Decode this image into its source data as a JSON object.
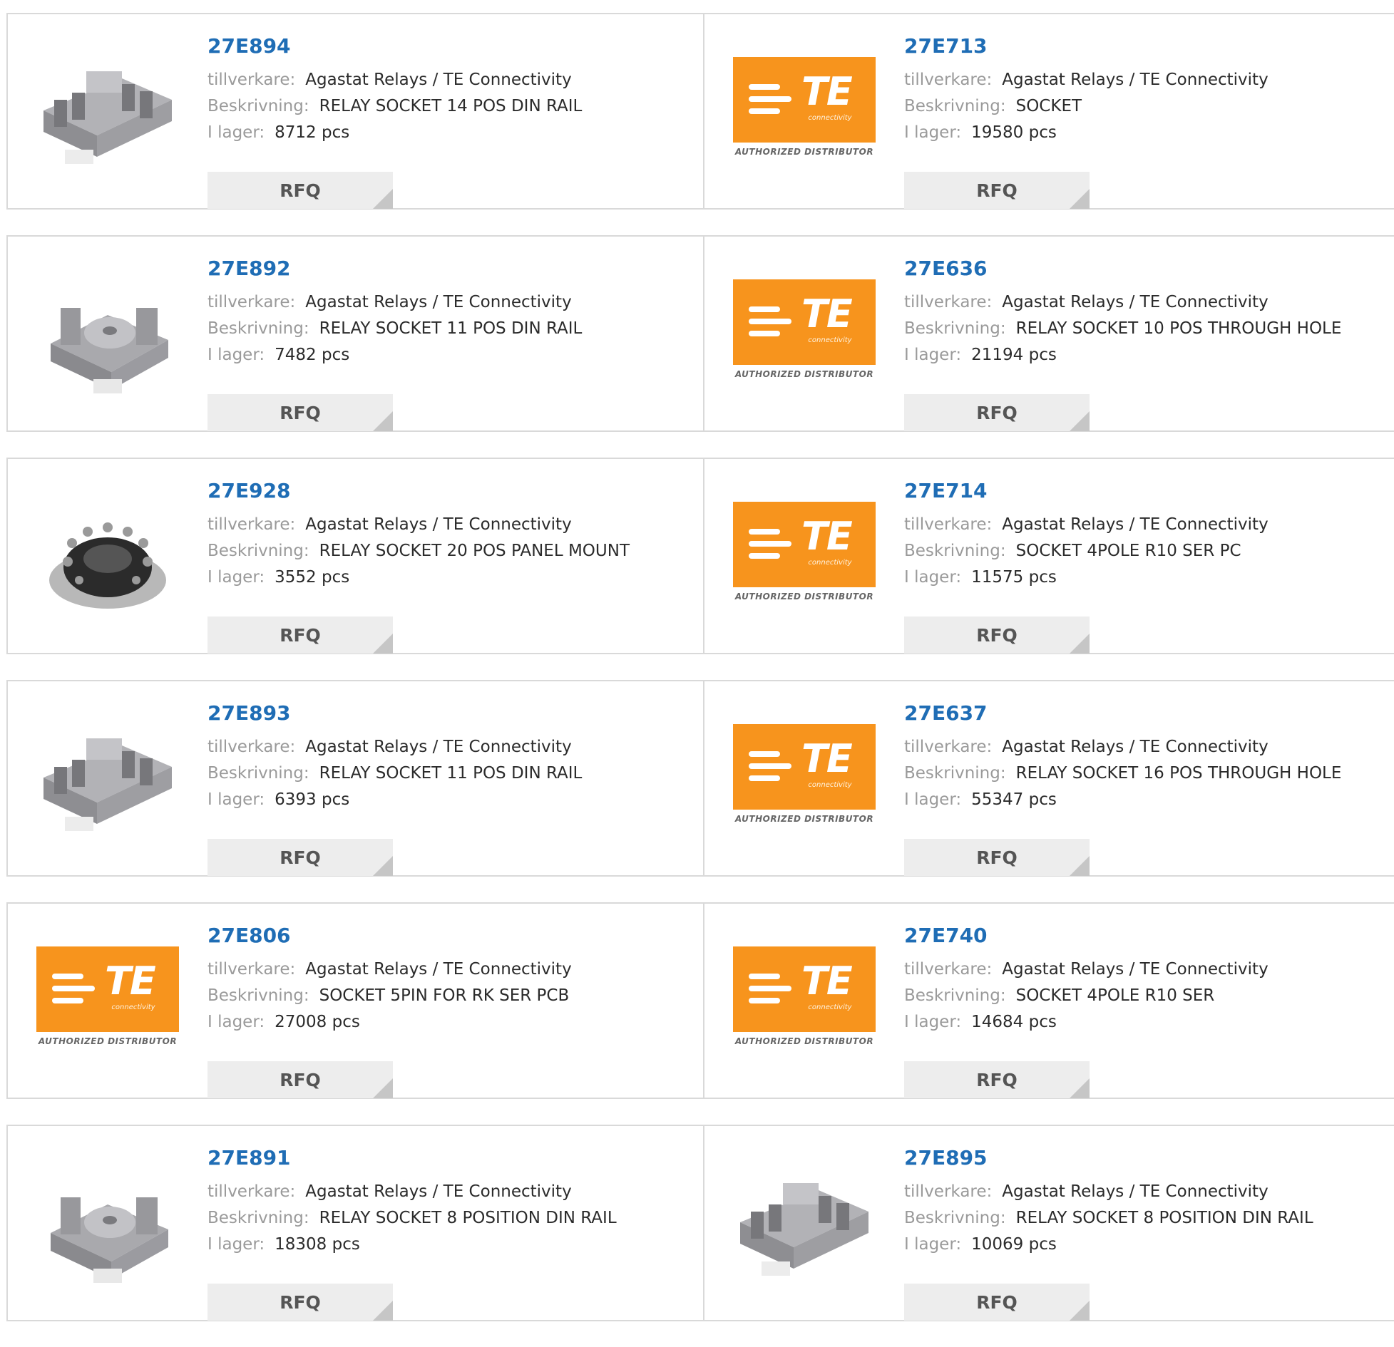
{
  "labels": {
    "manufacturer": "tillverkare:",
    "description": "Beskrivning:",
    "stock": "I lager:",
    "rfq": "RFQ"
  },
  "te_logo": {
    "wordmark": "TE",
    "sub": "connectivity",
    "caption": "AUTHORIZED DISTRIBUTOR",
    "color": "#f7941d"
  },
  "products": [
    {
      "part": "27E894",
      "manufacturer": "Agastat Relays / TE Connectivity",
      "description": "RELAY SOCKET 14 POS DIN RAIL",
      "stock": "8712 pcs",
      "image": "relay-socket-din-rail-photo"
    },
    {
      "part": "27E713",
      "manufacturer": "Agastat Relays / TE Connectivity",
      "description": "SOCKET",
      "stock": "19580 pcs",
      "image": "te-connectivity-logo"
    },
    {
      "part": "27E892",
      "manufacturer": "Agastat Relays / TE Connectivity",
      "description": "RELAY SOCKET 11 POS DIN RAIL",
      "stock": "7482 pcs",
      "image": "relay-socket-round-photo"
    },
    {
      "part": "27E636",
      "manufacturer": "Agastat Relays / TE Connectivity",
      "description": "RELAY SOCKET 10 POS THROUGH HOLE",
      "stock": "21194 pcs",
      "image": "te-connectivity-logo"
    },
    {
      "part": "27E928",
      "manufacturer": "Agastat Relays / TE Connectivity",
      "description": "RELAY SOCKET 20 POS PANEL MOUNT",
      "stock": "3552 pcs",
      "image": "panel-mount-socket-photo"
    },
    {
      "part": "27E714",
      "manufacturer": "Agastat Relays / TE Connectivity",
      "description": "SOCKET 4POLE R10 SER PC",
      "stock": "11575 pcs",
      "image": "te-connectivity-logo"
    },
    {
      "part": "27E893",
      "manufacturer": "Agastat Relays / TE Connectivity",
      "description": "RELAY SOCKET 11 POS DIN RAIL",
      "stock": "6393 pcs",
      "image": "relay-socket-din-rail-photo"
    },
    {
      "part": "27E637",
      "manufacturer": "Agastat Relays / TE Connectivity",
      "description": "RELAY SOCKET 16 POS THROUGH HOLE",
      "stock": "55347 pcs",
      "image": "te-connectivity-logo"
    },
    {
      "part": "27E806",
      "manufacturer": "Agastat Relays / TE Connectivity",
      "description": "SOCKET 5PIN FOR RK SER PCB",
      "stock": "27008 pcs",
      "image": "te-connectivity-logo"
    },
    {
      "part": "27E740",
      "manufacturer": "Agastat Relays / TE Connectivity",
      "description": "SOCKET 4POLE R10 SER",
      "stock": "14684 pcs",
      "image": "te-connectivity-logo"
    },
    {
      "part": "27E891",
      "manufacturer": "Agastat Relays / TE Connectivity",
      "description": "RELAY SOCKET 8 POSITION DIN RAIL",
      "stock": "18308 pcs",
      "image": "relay-socket-round-photo"
    },
    {
      "part": "27E895",
      "manufacturer": "Agastat Relays / TE Connectivity",
      "description": "RELAY SOCKET 8 POSITION DIN RAIL",
      "stock": "10069 pcs",
      "image": "relay-socket-din-rail-photo"
    }
  ]
}
